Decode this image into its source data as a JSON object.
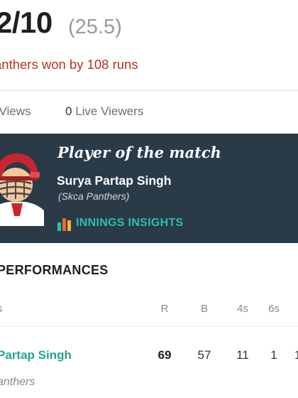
{
  "scorecard": {
    "score": "2/10",
    "overs": "(25.5)",
    "result": "anthers won by 108 runs"
  },
  "stats": {
    "views_label": "l Views",
    "live_viewers_count": "0",
    "live_viewers_label": "Live Viewers"
  },
  "player_of_match": {
    "title": "Player of the match",
    "name": "Surya Partap Singh",
    "team": "(Skca Panthers)",
    "insights_label": "INNINGS INSIGHTS",
    "colors": {
      "background": "#2a3a47",
      "insights": "#2cbfae",
      "helmet": "#c8262e"
    }
  },
  "performances": {
    "title": "PERFORMANCES",
    "columns": {
      "name": "s",
      "r": "R",
      "b": "B",
      "fours": "4s",
      "sixes": "6s"
    },
    "rows": [
      {
        "name": "Partap Singh",
        "team": "anthers",
        "r": "69",
        "b": "57",
        "fours": "11",
        "sixes": "1",
        "cut": "1"
      }
    ]
  }
}
